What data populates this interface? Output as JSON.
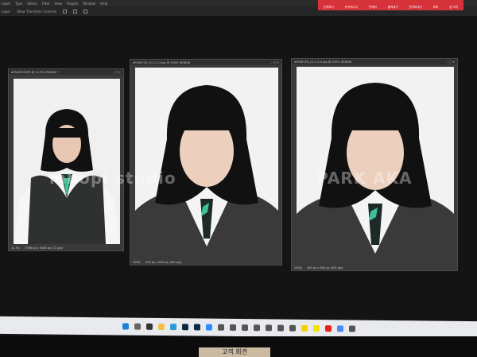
{
  "menu": [
    "Layer",
    "Type",
    "Select",
    "Filter",
    "View",
    "Plugins",
    "Window",
    "Help"
  ],
  "options": {
    "layer": "Layer",
    "transform": "Show Transform Controls"
  },
  "toolbar_red": [
    "전체보기",
    "문서메시지",
    "판매처",
    "출력대기",
    "문자보내기",
    "제조",
    "장 고객"
  ],
  "documents": [
    {
      "title": "AF5A9255.JPG @ 12.5% (RGB/8) *",
      "zoom": "12.5%",
      "size": "3766 px x 5008 px (72 ppi)"
    },
    {
      "title": "AF5A9729_(1)-1-2-3.jpg @ 200% (RGB/8)",
      "zoom": "200%",
      "size": "450 px x 600 px (300 ppi)"
    },
    {
      "title": "AF5A9729_(1)-1-2-4.jpg @ 200% (RGB/8)",
      "zoom": "200%",
      "size": "450 px x 600 px (300 ppi)"
    }
  ],
  "watermarks": [
    "mhopi studio",
    "PARK AKA"
  ],
  "taskbar_icons": [
    "windows",
    "search",
    "taskview",
    "explorer",
    "edge",
    "photoshop",
    "photoshop2",
    "zoom",
    "app",
    "app",
    "app",
    "app",
    "app",
    "app",
    "app",
    "kakao",
    "kakaotalk",
    "youtube",
    "chrome",
    "app"
  ],
  "sign": "고객 회견"
}
